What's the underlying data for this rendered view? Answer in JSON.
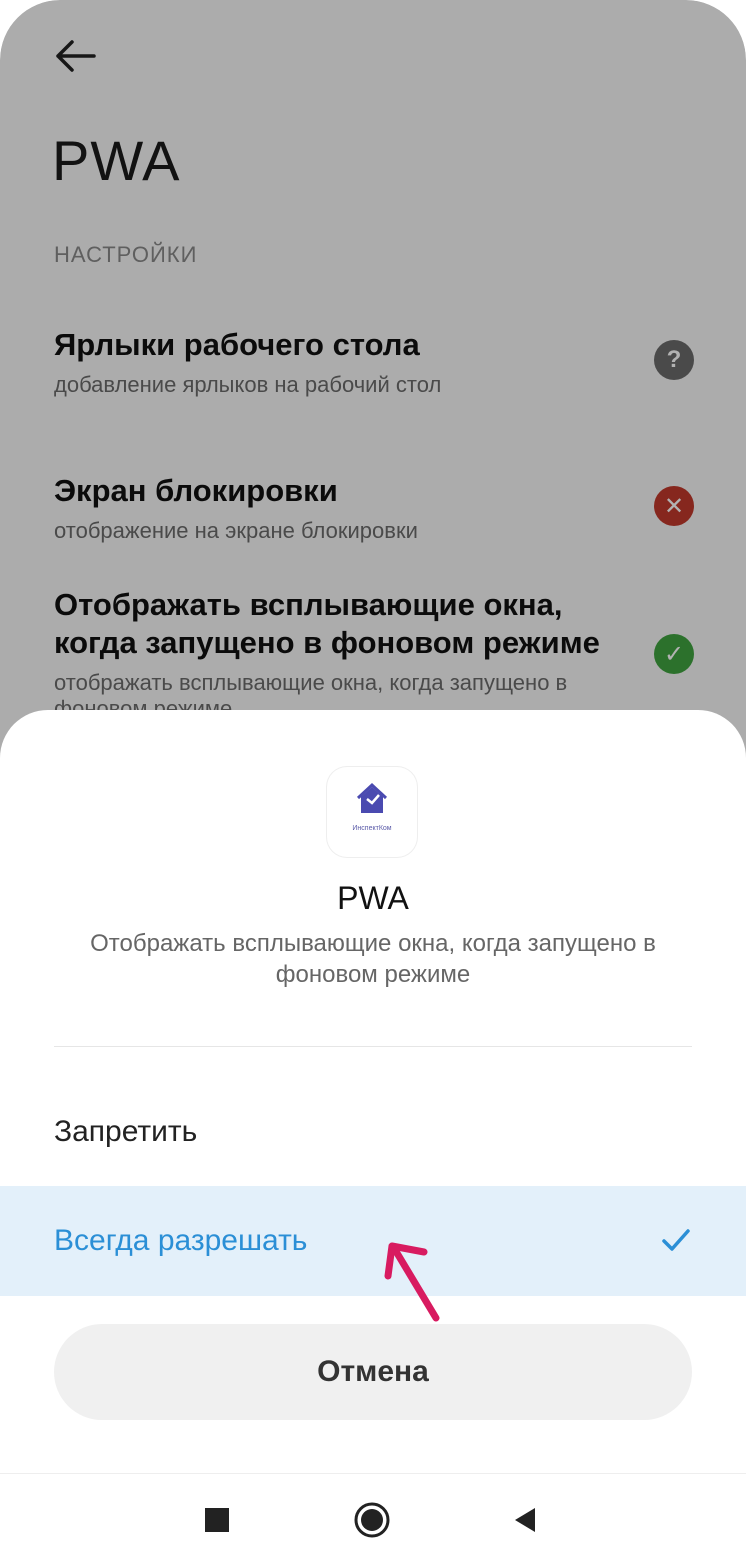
{
  "background_page": {
    "title": "PWA",
    "section_label": "НАСТРОЙКИ",
    "settings": [
      {
        "title": "Ярлыки рабочего стола",
        "subtitle": "добавление ярлыков на рабочий стол",
        "status": "unknown",
        "status_icon": "question-icon",
        "status_color": "#6b6b6b"
      },
      {
        "title": "Экран блокировки",
        "subtitle": "отображение на экране блокировки",
        "status": "denied",
        "status_icon": "cross-icon",
        "status_color": "#c0392b"
      },
      {
        "title": "Отображать всплывающие окна, когда запущено в фоновом режиме",
        "subtitle": "отображать всплывающие окна, когда запущено в фоновом режиме",
        "status": "allowed",
        "status_icon": "check-icon",
        "status_color": "#3fa33f"
      }
    ]
  },
  "sheet": {
    "app_icon_label": "ИнспектКом",
    "title": "PWA",
    "description": "Отображать всплывающие окна, когда запущено в фоновом режиме",
    "options": [
      {
        "label": "Запретить",
        "selected": false
      },
      {
        "label": "Всегда разрешать",
        "selected": true
      }
    ],
    "cancel_label": "Отмена",
    "accent_color": "#2b8fd6",
    "selected_bg": "#e3f0fa"
  },
  "annotation": {
    "arrow_color": "#d81b60"
  },
  "nav_bar": {
    "buttons": [
      "recents-square-icon",
      "home-circle-icon",
      "back-triangle-icon"
    ]
  }
}
